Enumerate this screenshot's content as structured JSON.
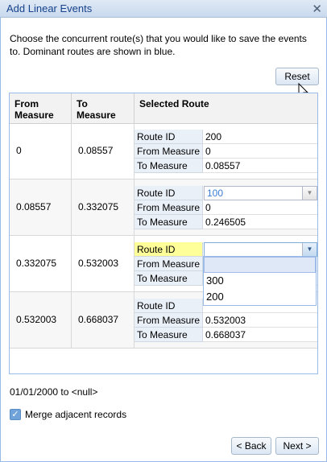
{
  "window": {
    "title": "Add Linear Events"
  },
  "instructions": "Choose the concurrent route(s) that you would like to save the events to. Dominant routes are shown in blue.",
  "reset_label": "Reset",
  "columns": {
    "from": "From\nMeasure",
    "to": "To\nMeasure",
    "route": "Selected Route"
  },
  "sub_labels": {
    "route_id": "Route ID",
    "from": "From Measure",
    "to": "To Measure"
  },
  "rows": [
    {
      "from": "0",
      "to": "0.08557",
      "route_id": "200",
      "route_from": "0",
      "route_to": "0.08557"
    },
    {
      "from": "0.08557",
      "to": "0.332075",
      "route_id": "100",
      "route_from": "0",
      "route_to": "0.246505"
    },
    {
      "from": "0.332075",
      "to": "0.532003",
      "route_id": "",
      "route_from": "",
      "route_to": ""
    },
    {
      "from": "0.532003",
      "to": "0.668037",
      "route_id": "",
      "route_from": "0.532003",
      "route_to": "0.668037"
    }
  ],
  "dropdown_options": [
    "",
    "300",
    "200"
  ],
  "date_range": "01/01/2000 to <null>",
  "merge_label": "Merge adjacent records",
  "merge_checked": true,
  "back_label": "< Back",
  "next_label": "Next >",
  "colors": {
    "dominant_route": "#3a7bd5",
    "highlight_field": "#ffff99",
    "border": "#99bbe8"
  }
}
